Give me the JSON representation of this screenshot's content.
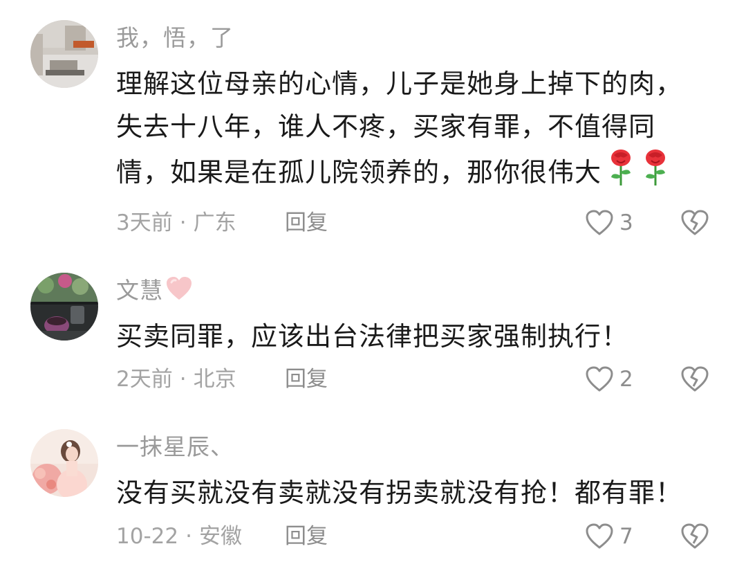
{
  "comments": [
    {
      "username": "我，悟，了",
      "content_lines": [
        "理解这位母亲的心情，儿子是她身上掉下的肉，",
        "失去十八年，谁人不疼，买家有罪，不值得同",
        "情，如果是在孤儿院领养的，那你很伟大"
      ],
      "emoji": [
        "rose-emoji",
        "rose-emoji"
      ],
      "time": "3天前",
      "separator": "·",
      "location": "广东",
      "reply_label": "回复",
      "likes": "3"
    },
    {
      "username": "文慧",
      "username_emoji": "pink-heart-emoji",
      "content_lines": [
        "买卖同罪，应该出台法律把买家强制执行！"
      ],
      "time": "2天前",
      "separator": "·",
      "location": "北京",
      "reply_label": "回复",
      "likes": "2"
    },
    {
      "username": "一抹星辰、",
      "content_lines": [
        "没有买就没有卖就没有拐卖就没有抢！都有罪！"
      ],
      "time": "10-22",
      "separator": "·",
      "location": "安徽",
      "reply_label": "回复",
      "likes": "7"
    }
  ],
  "colors": {
    "username": "#9a9a9a",
    "content": "#1a1a1a",
    "meta": "#a3a3a3",
    "action": "#8d8d8d",
    "rose": "#e8323a",
    "pink_heart": "#f7c6c9"
  },
  "icons": {
    "like": "heart-outline-icon",
    "dislike": "broken-heart-icon"
  }
}
